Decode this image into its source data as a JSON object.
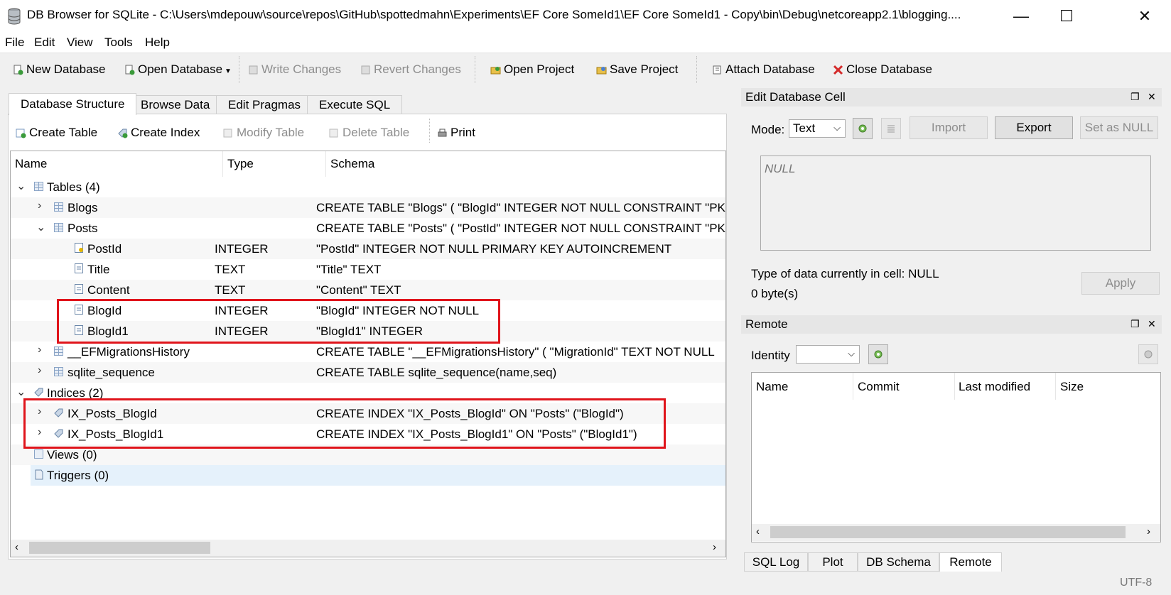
{
  "window": {
    "title": "DB Browser for SQLite - C:\\Users\\mdepouw\\source\\repos\\GitHub\\spottedmahn\\Experiments\\EF Core SomeId1\\EF Core SomeId1 - Copy\\bin\\Debug\\netcoreapp2.1\\blogging....",
    "minimize": "—",
    "maximize": "☐",
    "close": "✕"
  },
  "menu": [
    "File",
    "Edit",
    "View",
    "Tools",
    "Help"
  ],
  "toolbar": {
    "new_database": "New Database",
    "open_database": "Open Database",
    "write_changes": "Write Changes",
    "revert_changes": "Revert Changes",
    "open_project": "Open Project",
    "save_project": "Save Project",
    "attach_database": "Attach Database",
    "close_database": "Close Database"
  },
  "tabs": [
    "Database Structure",
    "Browse Data",
    "Edit Pragmas",
    "Execute SQL"
  ],
  "structure_toolbar": {
    "create_table": "Create Table",
    "create_index": "Create Index",
    "modify_table": "Modify Table",
    "delete_table": "Delete Table",
    "print": "Print"
  },
  "tree": {
    "headers": [
      "Name",
      "Type",
      "Schema"
    ],
    "rows": [
      {
        "name": "Tables (4)",
        "type": "",
        "schema": ""
      },
      {
        "name": "Blogs",
        "type": "",
        "schema": "CREATE TABLE \"Blogs\" ( \"BlogId\" INTEGER NOT NULL CONSTRAINT \"PK"
      },
      {
        "name": "Posts",
        "type": "",
        "schema": "CREATE TABLE \"Posts\" ( \"PostId\" INTEGER NOT NULL CONSTRAINT \"PK"
      },
      {
        "name": "PostId",
        "type": "INTEGER",
        "schema": "\"PostId\" INTEGER NOT NULL PRIMARY KEY AUTOINCREMENT"
      },
      {
        "name": "Title",
        "type": "TEXT",
        "schema": "\"Title\" TEXT"
      },
      {
        "name": "Content",
        "type": "TEXT",
        "schema": "\"Content\" TEXT"
      },
      {
        "name": "BlogId",
        "type": "INTEGER",
        "schema": "\"BlogId\" INTEGER NOT NULL"
      },
      {
        "name": "BlogId1",
        "type": "INTEGER",
        "schema": "\"BlogId1\" INTEGER"
      },
      {
        "name": "__EFMigrationsHistory",
        "type": "",
        "schema": "CREATE TABLE \"__EFMigrationsHistory\" ( \"MigrationId\" TEXT NOT NULL"
      },
      {
        "name": "sqlite_sequence",
        "type": "",
        "schema": "CREATE TABLE sqlite_sequence(name,seq)"
      },
      {
        "name": "Indices (2)",
        "type": "",
        "schema": ""
      },
      {
        "name": "IX_Posts_BlogId",
        "type": "",
        "schema": "CREATE INDEX \"IX_Posts_BlogId\" ON \"Posts\" (\"BlogId\")"
      },
      {
        "name": "IX_Posts_BlogId1",
        "type": "",
        "schema": "CREATE INDEX \"IX_Posts_BlogId1\" ON \"Posts\" (\"BlogId1\")"
      },
      {
        "name": "Views (0)",
        "type": "",
        "schema": ""
      },
      {
        "name": "Triggers (0)",
        "type": "",
        "schema": ""
      }
    ]
  },
  "edit_cell": {
    "title": "Edit Database Cell",
    "mode_label": "Mode:",
    "mode_value": "Text",
    "import": "Import",
    "export": "Export",
    "set_null": "Set as NULL",
    "cell_value": "NULL",
    "type_info": "Type of data currently in cell: NULL",
    "size_info": "0 byte(s)",
    "apply": "Apply"
  },
  "remote": {
    "title": "Remote",
    "identity_label": "Identity",
    "headers": [
      "Name",
      "Commit",
      "Last modified",
      "Size"
    ]
  },
  "bottom_tabs": [
    "SQL Log",
    "Plot",
    "DB Schema",
    "Remote"
  ],
  "status": {
    "encoding": "UTF-8"
  },
  "colors": {
    "highlight_red": "#e0141b",
    "selection": "#e5f1fb"
  }
}
